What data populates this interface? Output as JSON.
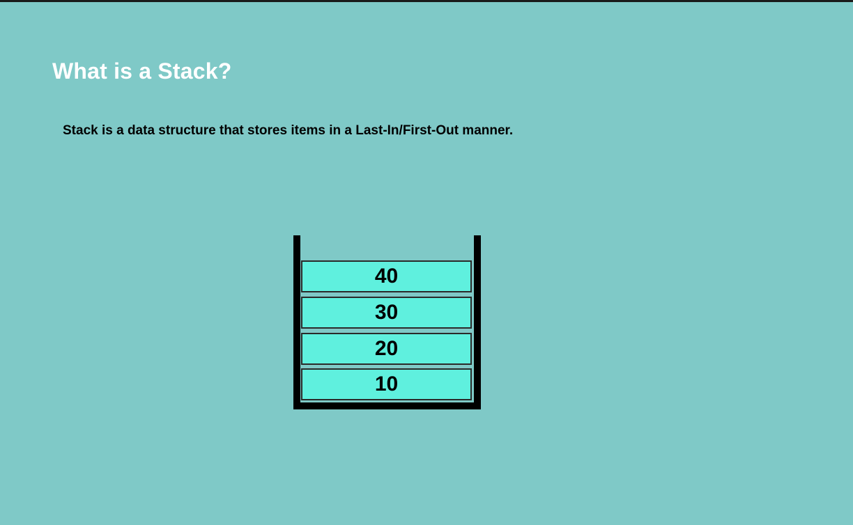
{
  "slide": {
    "title": "What is a Stack?",
    "description": "Stack is a data structure that stores items in a Last-In/First-Out manner."
  },
  "stack": {
    "items": [
      "40",
      "30",
      "20",
      "10"
    ]
  },
  "colors": {
    "background": "#7fc9c7",
    "item_fill": "#5ff0de",
    "container": "#000000"
  }
}
